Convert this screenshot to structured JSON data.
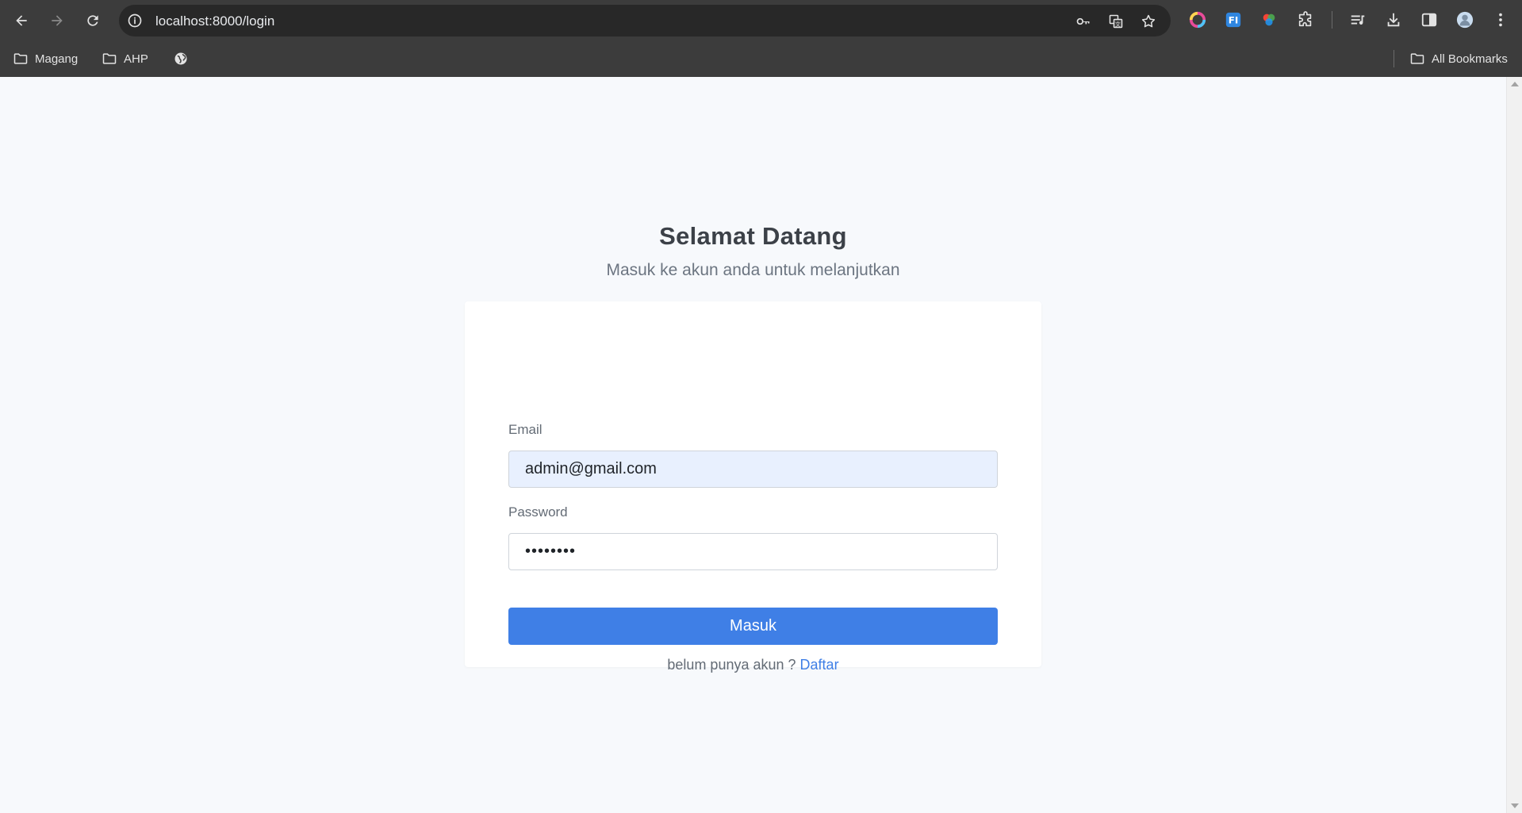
{
  "browser": {
    "url": "localhost:8000/login",
    "bookmarks": [
      {
        "label": "Magang",
        "icon": "folder-icon"
      },
      {
        "label": "AHP",
        "icon": "folder-icon"
      },
      {
        "label": "",
        "icon": "globe-icon"
      }
    ],
    "all_bookmarks_label": "All Bookmarks"
  },
  "login": {
    "title": "Selamat Datang",
    "subtitle": "Masuk ke akun anda untuk melanjutkan",
    "email_label": "Email",
    "email_value": "admin@gmail.com",
    "password_label": "Password",
    "password_value": "password",
    "submit_label": "Masuk",
    "register_prompt": "belum punya akun ?",
    "register_link": "Daftar"
  },
  "colors": {
    "accent": "#3f7fe6",
    "page_bg": "#f7f9fc",
    "chrome_bg": "#3c3c3c",
    "autofill_bg": "#e8f0fe"
  }
}
